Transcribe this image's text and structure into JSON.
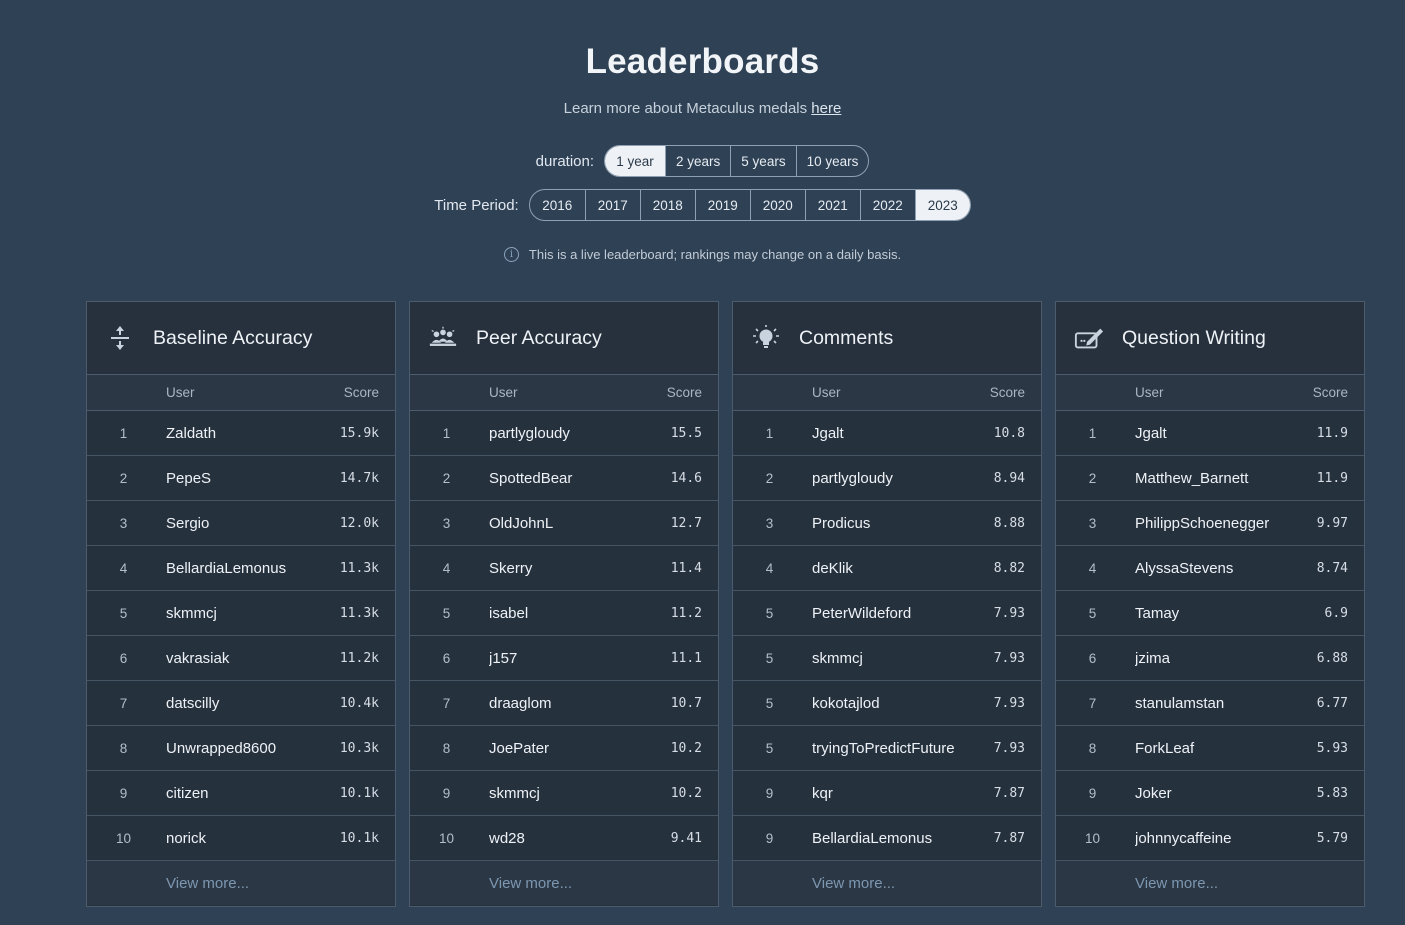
{
  "header": {
    "title": "Leaderboards",
    "subtitle_prefix": "Learn more about Metaculus medals ",
    "subtitle_link": "here"
  },
  "duration": {
    "label": "duration:",
    "options": [
      "1 year",
      "2 years",
      "5 years",
      "10 years"
    ],
    "selected": "1 year"
  },
  "time_period": {
    "label": "Time Period:",
    "options": [
      "2016",
      "2017",
      "2018",
      "2019",
      "2020",
      "2021",
      "2022",
      "2023"
    ],
    "selected": "2023"
  },
  "notice": "This is a live leaderboard; rankings may change on a daily basis.",
  "columns": {
    "user": "User",
    "score": "Score"
  },
  "view_more": "View more...",
  "boards": [
    {
      "title": "Baseline Accuracy",
      "icon": "baseline-accuracy-icon",
      "rows": [
        [
          "1",
          "Zaldath",
          "15.9k"
        ],
        [
          "2",
          "PepeS",
          "14.7k"
        ],
        [
          "3",
          "Sergio",
          "12.0k"
        ],
        [
          "4",
          "BellardiaLemonus",
          "11.3k"
        ],
        [
          "5",
          "skmmcj",
          "11.3k"
        ],
        [
          "6",
          "vakrasiak",
          "11.2k"
        ],
        [
          "7",
          "datscilly",
          "10.4k"
        ],
        [
          "8",
          "Unwrapped8600",
          "10.3k"
        ],
        [
          "9",
          "citizen",
          "10.1k"
        ],
        [
          "10",
          "norick",
          "10.1k"
        ]
      ]
    },
    {
      "title": "Peer Accuracy",
      "icon": "peer-accuracy-icon",
      "rows": [
        [
          "1",
          "partlygloudy",
          "15.5"
        ],
        [
          "2",
          "SpottedBear",
          "14.6"
        ],
        [
          "3",
          "OldJohnL",
          "12.7"
        ],
        [
          "4",
          "Skerry",
          "11.4"
        ],
        [
          "5",
          "isabel",
          "11.2"
        ],
        [
          "6",
          "j157",
          "11.1"
        ],
        [
          "7",
          "draaglom",
          "10.7"
        ],
        [
          "8",
          "JoePater",
          "10.2"
        ],
        [
          "9",
          "skmmcj",
          "10.2"
        ],
        [
          "10",
          "wd28",
          "9.41"
        ]
      ]
    },
    {
      "title": "Comments",
      "icon": "lightbulb-icon",
      "rows": [
        [
          "1",
          "Jgalt",
          "10.8"
        ],
        [
          "2",
          "partlygloudy",
          "8.94"
        ],
        [
          "3",
          "Prodicus",
          "8.88"
        ],
        [
          "4",
          "deKlik",
          "8.82"
        ],
        [
          "5",
          "PeterWildeford",
          "7.93"
        ],
        [
          "5",
          "skmmcj",
          "7.93"
        ],
        [
          "5",
          "kokotajlod",
          "7.93"
        ],
        [
          "5",
          "tryingToPredictFuture",
          "7.93"
        ],
        [
          "9",
          "kqr",
          "7.87"
        ],
        [
          "9",
          "BellardiaLemonus",
          "7.87"
        ]
      ]
    },
    {
      "title": "Question Writing",
      "icon": "edit-question-icon",
      "rows": [
        [
          "1",
          "Jgalt",
          "11.9"
        ],
        [
          "2",
          "Matthew_Barnett",
          "11.9"
        ],
        [
          "3",
          "PhilippSchoenegger",
          "9.97"
        ],
        [
          "4",
          "AlyssaStevens",
          "8.74"
        ],
        [
          "5",
          "Tamay",
          "6.9"
        ],
        [
          "6",
          "jzima",
          "6.88"
        ],
        [
          "7",
          "stanulamstan",
          "6.77"
        ],
        [
          "8",
          "ForkLeaf",
          "5.93"
        ],
        [
          "9",
          "Joker",
          "5.83"
        ],
        [
          "10",
          "johnnycaffeine",
          "5.79"
        ]
      ]
    }
  ]
}
